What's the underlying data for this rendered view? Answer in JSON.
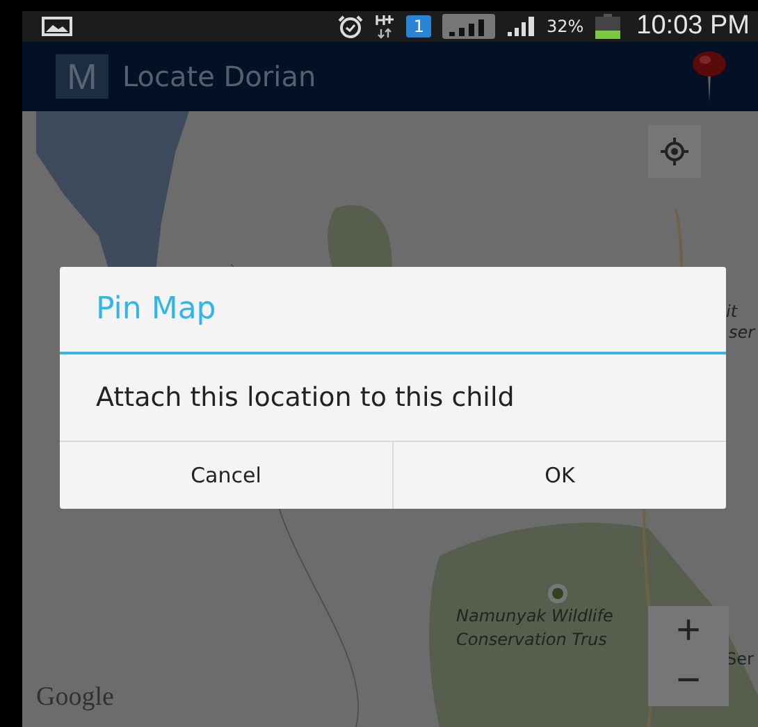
{
  "status_bar": {
    "notification_count": "1",
    "battery": "32%",
    "time": "10:03 PM"
  },
  "action_bar": {
    "logo_letter": "M",
    "title": "Locate Dorian"
  },
  "map": {
    "labels": [
      {
        "kind": "place",
        "text": "it"
      },
      {
        "kind": "place",
        "text": "ser"
      },
      {
        "kind": "place",
        "text": "Namunyak Wildlife"
      },
      {
        "kind": "place",
        "text": "Conservation Trus"
      },
      {
        "kind": "place",
        "text": "Ser"
      },
      {
        "kind": "attribution",
        "text": "Google"
      }
    ],
    "zoom_in": "+",
    "zoom_out": "−"
  },
  "dialog": {
    "title": "Pin Map",
    "message": "Attach this location to this child",
    "buttons": [
      "Cancel",
      "OK"
    ]
  }
}
